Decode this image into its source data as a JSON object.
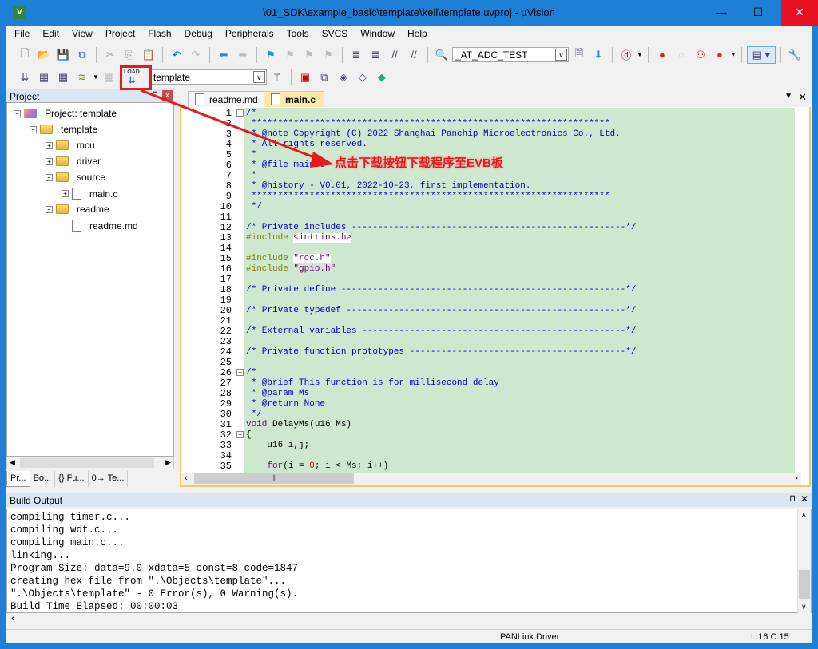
{
  "window": {
    "title": "\\01_SDK\\example_basic\\template\\keil\\template.uvproj - µVision",
    "app_icon": "uvision-logo"
  },
  "menu": [
    "File",
    "Edit",
    "View",
    "Project",
    "Flash",
    "Debug",
    "Peripherals",
    "Tools",
    "SVCS",
    "Window",
    "Help"
  ],
  "toolbar1": {
    "find_combo": "_AT_ADC_TEST"
  },
  "toolbar2": {
    "load_label": "LOAD",
    "target_combo": "template"
  },
  "project": {
    "title": "Project",
    "tree": [
      {
        "label": "Project: template",
        "level": 0,
        "toggle": "−",
        "icon": "project"
      },
      {
        "label": "template",
        "level": 1,
        "toggle": "−",
        "icon": "folder-open"
      },
      {
        "label": "mcu",
        "level": 2,
        "toggle": "+",
        "icon": "folder"
      },
      {
        "label": "driver",
        "level": 2,
        "toggle": "+",
        "icon": "folder"
      },
      {
        "label": "source",
        "level": 2,
        "toggle": "−",
        "icon": "folder-open"
      },
      {
        "label": "main.c",
        "level": 3,
        "toggle": "+",
        "icon": "file"
      },
      {
        "label": "readme",
        "level": 2,
        "toggle": "−",
        "icon": "folder-open"
      },
      {
        "label": "readme.md",
        "level": 3,
        "toggle": "",
        "icon": "file"
      }
    ],
    "tabs": [
      "Pr...",
      "Bo...",
      "{} Fu...",
      "0→ Te..."
    ]
  },
  "editor": {
    "tabs": [
      "readme.md",
      "main.c"
    ],
    "active_tab": "main.c",
    "lines": [
      [
        [
          "/*",
          "comment"
        ]
      ],
      [
        [
          " ********************************************************************",
          "comment"
        ]
      ],
      [
        [
          " * @note Copyright (C) 2022 Shanghai Panchip Microelectronics Co., Ltd.",
          "comment"
        ]
      ],
      [
        [
          " * All rights reserved.",
          "comment"
        ]
      ],
      [
        [
          " *",
          "comment"
        ]
      ],
      [
        [
          " * @file main.c",
          "comment"
        ]
      ],
      [
        [
          " *",
          "comment"
        ]
      ],
      [
        [
          " * @history - V0.01, 2022-10-23, first implementation.",
          "comment"
        ]
      ],
      [
        [
          " ********************************************************************",
          "comment"
        ]
      ],
      [
        [
          " */",
          "comment"
        ]
      ],
      [
        [
          "",
          "plain"
        ]
      ],
      [
        [
          "/* Private includes ----------------------------------------------------*/",
          "comment"
        ]
      ],
      [
        [
          "#include ",
          "pre"
        ],
        [
          "<intrins.h>",
          "str hl"
        ]
      ],
      [
        [
          "",
          "plain"
        ]
      ],
      [
        [
          "#include ",
          "pre"
        ],
        [
          "\"rcc.h\"",
          "str hl"
        ]
      ],
      [
        [
          "#include ",
          "pre"
        ],
        [
          "\"gpio.h\"",
          "str"
        ]
      ],
      [
        [
          "",
          "plain"
        ]
      ],
      [
        [
          "/* Private define ------------------------------------------------------*/",
          "comment"
        ]
      ],
      [
        [
          "",
          "plain"
        ]
      ],
      [
        [
          "/* Private typedef -----------------------------------------------------*/",
          "comment"
        ]
      ],
      [
        [
          "",
          "plain"
        ]
      ],
      [
        [
          "/* External variables --------------------------------------------------*/",
          "comment"
        ]
      ],
      [
        [
          "",
          "plain"
        ]
      ],
      [
        [
          "/* Private function prototypes -----------------------------------------*/",
          "comment"
        ]
      ],
      [
        [
          "",
          "plain"
        ]
      ],
      [
        [
          "/*",
          "comment"
        ]
      ],
      [
        [
          " * @brief This function is for millisecond delay",
          "comment"
        ]
      ],
      [
        [
          " * @param Ms",
          "comment"
        ]
      ],
      [
        [
          " * @return None",
          "comment"
        ]
      ],
      [
        [
          " */",
          "comment"
        ]
      ],
      [
        [
          "void",
          "kw"
        ],
        [
          " DelayMs(u16 Ms)",
          "plain"
        ]
      ],
      [
        [
          "{",
          "plain"
        ]
      ],
      [
        [
          "    u16 i,j;",
          "plain"
        ]
      ],
      [
        [
          "",
          "plain"
        ]
      ],
      [
        [
          "    ",
          "plain"
        ],
        [
          "for",
          "kw"
        ],
        [
          "(i = ",
          "plain"
        ],
        [
          "0",
          "num"
        ],
        [
          "; i < Ms; i++)",
          "plain"
        ]
      ]
    ],
    "folds": {
      "1": "−",
      "26": "−",
      "32": "−"
    }
  },
  "build_output": {
    "title": "Build Output",
    "lines": [
      "compiling timer.c...",
      "compiling wdt.c...",
      "compiling main.c...",
      "linking...",
      "Program Size: data=9.0 xdata=5 const=8 code=1847",
      "creating hex file from \".\\Objects\\template\"...",
      "\".\\Objects\\template\" - 0 Error(s), 0 Warning(s).",
      "Build Time Elapsed:  00:00:03"
    ]
  },
  "status": {
    "driver": "PANLink Driver",
    "position": "L:16 C:15"
  },
  "annotation": {
    "text": "点击下载按钮下载程序至EVB板",
    "color": "#e8191a"
  }
}
